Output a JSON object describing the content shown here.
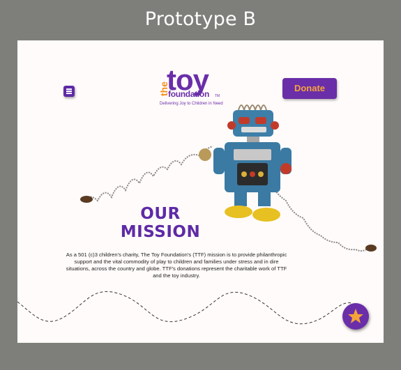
{
  "frame": {
    "title": "Prototype B"
  },
  "header": {
    "logo_the": "the",
    "logo_toy": "toy",
    "logo_foundation": "foundation",
    "logo_tm": "TM",
    "tagline": "Delivering Joy to Children in Need",
    "donate_label": "Donate"
  },
  "mission": {
    "heading_line1": "OUR",
    "heading_line2": "MISSION",
    "body": "As a 501 (c)3 children's charity, The Toy Foundation's (TTF) mission is to provide philanthropic support and the vital commodity of play to children and families under stress and in dire situations, across the country and globe. TTF's donations represent the charitable work of TTF and the toy industry."
  },
  "icons": {
    "menu": "hamburger-menu-icon",
    "fab": "star-icon"
  },
  "colors": {
    "frame_bg": "#7e7f7a",
    "canvas_bg": "#fffbfa",
    "brand_purple": "#6a2ea9",
    "brand_orange": "#f5901e",
    "star_orange": "#f5a23a"
  }
}
